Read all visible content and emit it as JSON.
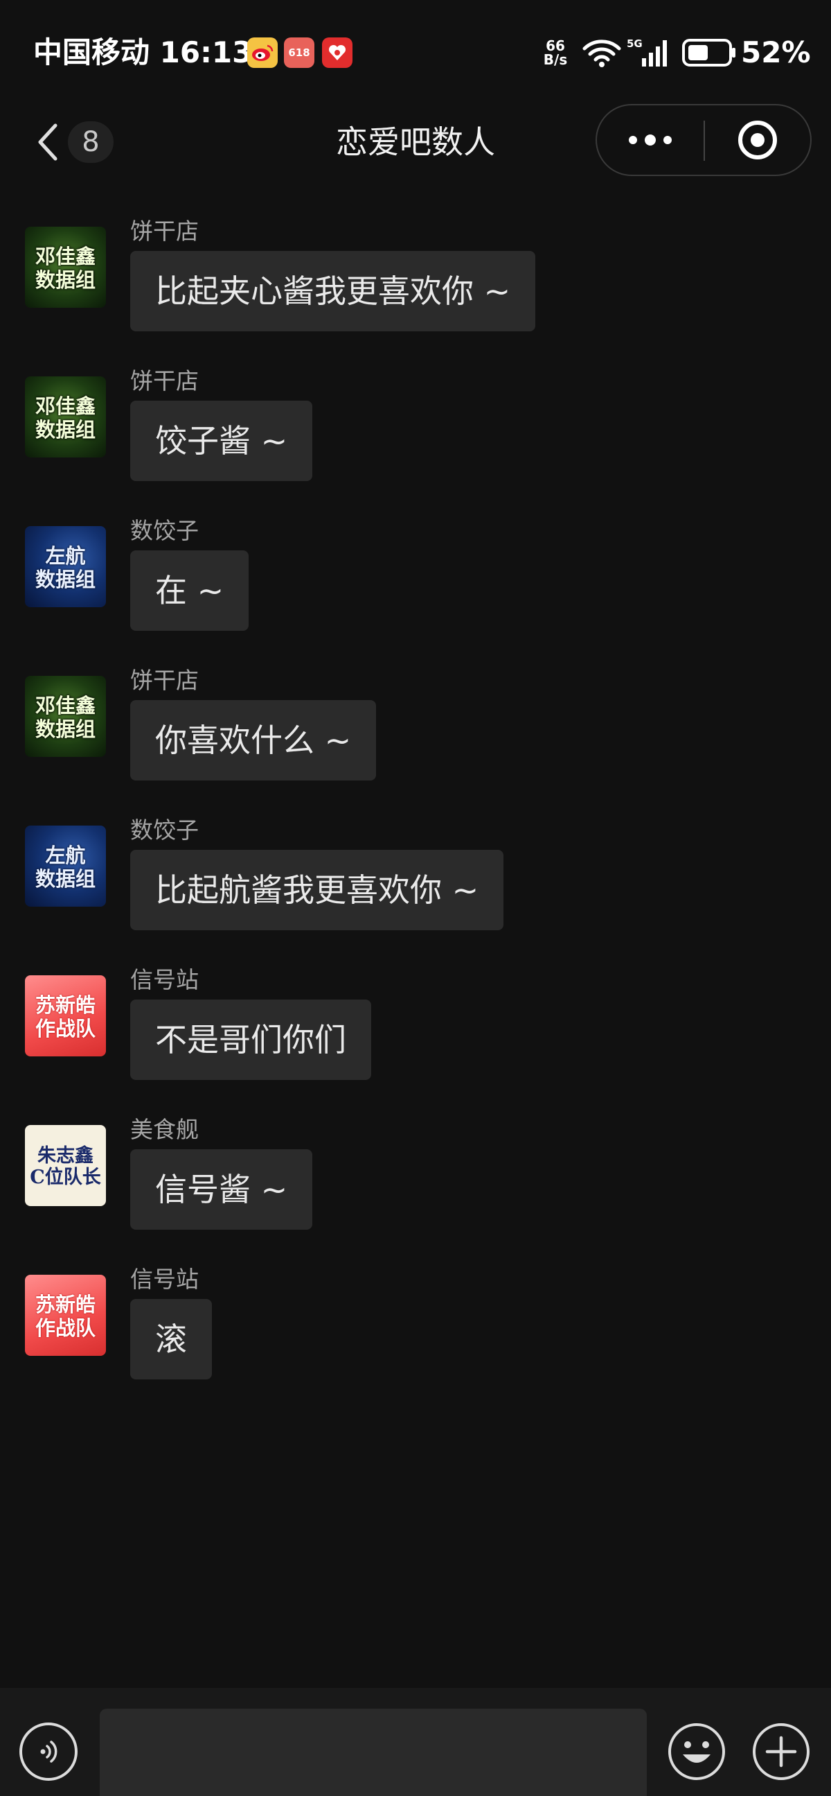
{
  "status_bar": {
    "carrier_time": "中国移动 16:13",
    "app_icons": [
      "weibo-icon",
      "taobao-618-icon",
      "jd-618-icon"
    ],
    "app_icon_labels": {
      "tb": "618",
      "jd": "618"
    },
    "net_speed_top": "66",
    "net_speed_bottom": "B/s",
    "network": "5G",
    "battery_percent": "52%",
    "battery_level": 0.52
  },
  "nav": {
    "unread_count": "8",
    "title": "恋爱吧数人"
  },
  "messages": [
    {
      "sender": "饼干店",
      "text": "比起夹心酱我更喜欢你 ~",
      "avatar": {
        "style": "forest",
        "line1": "邓佳鑫",
        "line2": "数据组"
      }
    },
    {
      "sender": "饼干店",
      "text": "饺子酱 ~",
      "avatar": {
        "style": "forest",
        "line1": "邓佳鑫",
        "line2": "数据组"
      }
    },
    {
      "sender": "数饺子",
      "text": "在 ~",
      "avatar": {
        "style": "galaxy",
        "line1": "左航",
        "line2": "数据组"
      }
    },
    {
      "sender": "饼干店",
      "text": "你喜欢什么 ~",
      "avatar": {
        "style": "forest",
        "line1": "邓佳鑫",
        "line2": "数据组"
      }
    },
    {
      "sender": "数饺子",
      "text": "比起航酱我更喜欢你 ~",
      "avatar": {
        "style": "galaxy",
        "line1": "左航",
        "line2": "数据组"
      }
    },
    {
      "sender": "信号站",
      "text": "不是哥们你们",
      "avatar": {
        "style": "red",
        "line1": "苏新皓",
        "line2": "作战队"
      }
    },
    {
      "sender": "美食舰",
      "text": "信号酱 ~",
      "avatar": {
        "style": "gold",
        "line1": "朱志鑫",
        "line2": "C位队长"
      }
    },
    {
      "sender": "信号站",
      "text": "滚",
      "avatar": {
        "style": "red",
        "line1": "苏新皓",
        "line2": "作战队"
      }
    }
  ],
  "input_bar": {
    "placeholder": ""
  },
  "colors": {
    "background": "#111111",
    "bubble": "#2b2b2b",
    "sender_text": "#a6a6a6",
    "message_text": "#eaeaea"
  }
}
